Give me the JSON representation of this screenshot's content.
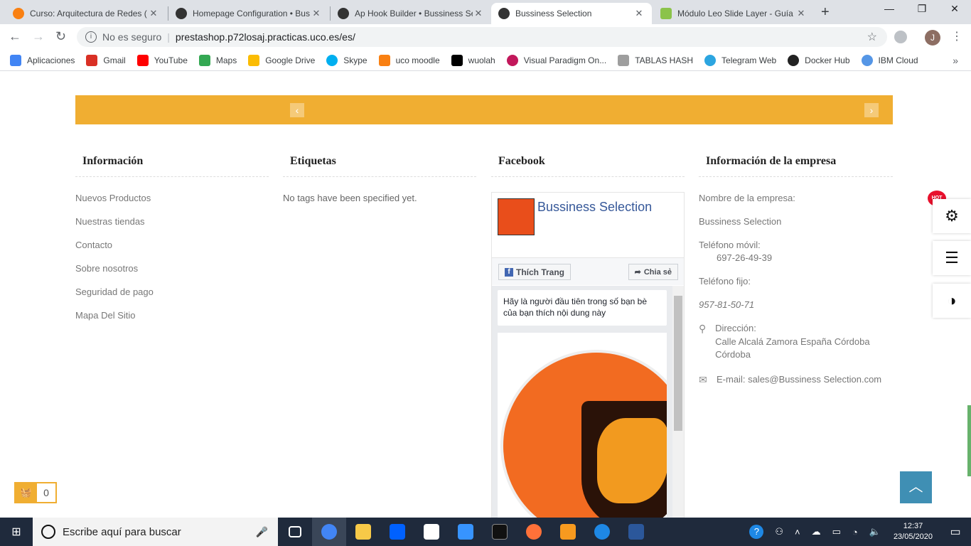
{
  "browser": {
    "tabs": [
      {
        "title": "Curso: Arquitectura de Redes (",
        "color": "#f98012"
      },
      {
        "title": "Homepage Configuration • Bus",
        "color": "#333333"
      },
      {
        "title": "Ap Hook Builder • Bussiness Se",
        "color": "#333333"
      },
      {
        "title": "Bussiness Selection",
        "color": "#333333",
        "active": true
      },
      {
        "title": "Módulo Leo Slide Layer - Guía",
        "color": "#8bc34a"
      }
    ],
    "tab_close": "✕",
    "new_tab": "+",
    "window_controls": {
      "minimize": "—",
      "maximize": "❐",
      "close": "✕"
    },
    "address": {
      "security": "No es seguro",
      "url": "prestashop.p72losaj.practicas.uco.es/es/"
    },
    "avatar_initial": "J",
    "bookmarks": [
      {
        "label": "Aplicaciones",
        "color": "#4285f4"
      },
      {
        "label": "Gmail",
        "color": "#d93025"
      },
      {
        "label": "YouTube",
        "color": "#ff0000"
      },
      {
        "label": "Maps",
        "color": "#34a853"
      },
      {
        "label": "Google Drive",
        "color": "#fbbc04"
      },
      {
        "label": "Skype",
        "color": "#00aff0"
      },
      {
        "label": "uco moodle",
        "color": "#f98012"
      },
      {
        "label": "wuolah",
        "color": "#000000"
      },
      {
        "label": "Visual Paradigm On...",
        "color": "#c2185b"
      },
      {
        "label": "TABLAS HASH",
        "color": "#9e9e9e"
      },
      {
        "label": "Telegram Web",
        "color": "#2ca5e0"
      },
      {
        "label": "Docker Hub",
        "color": "#222222"
      },
      {
        "label": "IBM Cloud",
        "color": "#5596e6"
      }
    ],
    "bookmarks_more": "»"
  },
  "footer": {
    "informacion": {
      "title": "Información",
      "links": [
        "Nuevos Productos",
        "Nuestras tiendas",
        "Contacto",
        "Sobre nosotros",
        "Seguridad de pago",
        "Mapa Del Sitio"
      ]
    },
    "etiquetas": {
      "title": "Etiquetas",
      "empty": "No tags have been specified yet."
    },
    "facebook": {
      "title": "Facebook",
      "page_name": "Bussiness Selection",
      "like_label": "Thích Trang",
      "share_label": "Chia sẻ",
      "message": "Hãy là người đầu tiên trong số bạn bè của bạn thích nội dung này"
    },
    "empresa": {
      "title": "Información de la empresa",
      "name_label": "Nombre de la empresa:",
      "name_value": "Bussiness Selection",
      "mobile_label": "Teléfono móvil:",
      "mobile_value": "697-26-49-39",
      "phone_label": "Teléfono fijo:",
      "phone_value": "957-81-50-71",
      "address_label": "Dirección:",
      "address_value": "Calle Alcalá Zamora España Córdoba Córdoba",
      "email_label": "E-mail:",
      "email_value": "sales@Bussiness Selection.com"
    }
  },
  "widgets": {
    "hot_badge": "HOT",
    "cart_count": "0",
    "accent": "#f0ae32",
    "totop_color": "#3f8fb4"
  },
  "taskbar": {
    "search_placeholder": "Escribe aquí para buscar",
    "time": "12:37",
    "date": "23/05/2020",
    "apps": [
      {
        "name": "task-view",
        "color": "#ffffff"
      },
      {
        "name": "chrome",
        "color": "#4285f4",
        "active": true
      },
      {
        "name": "file-explorer",
        "color": "#f7c948"
      },
      {
        "name": "dropbox",
        "color": "#0061ff"
      },
      {
        "name": "store",
        "color": "#ffffff"
      },
      {
        "name": "visual-studio",
        "color": "#3794ff"
      },
      {
        "name": "terminal",
        "color": "#111111"
      },
      {
        "name": "firefox",
        "color": "#ff7139"
      },
      {
        "name": "sublime",
        "color": "#f79a1f"
      },
      {
        "name": "edge",
        "color": "#1e88e5"
      },
      {
        "name": "word",
        "color": "#2b579a"
      }
    ]
  }
}
